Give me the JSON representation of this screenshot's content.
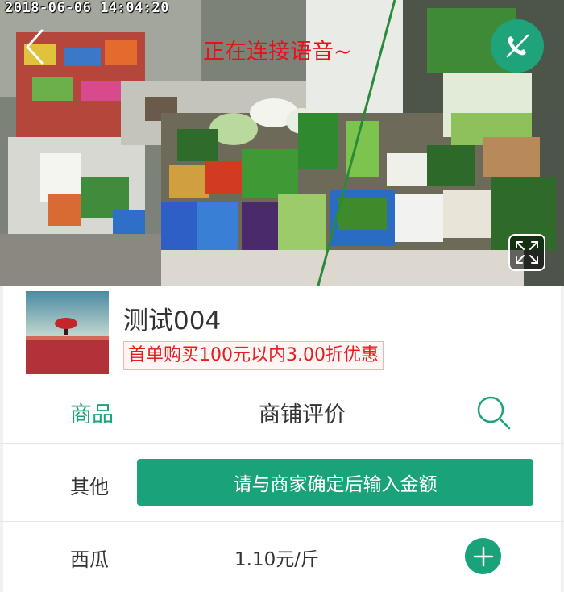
{
  "video": {
    "timestamp": "2018-06-06  14:04:20",
    "status_text": "正在连接语音~"
  },
  "store": {
    "name": "测试004",
    "promo": "首单购买100元以内3.00折优惠"
  },
  "tabs": [
    {
      "label": "商品",
      "active": true
    },
    {
      "label": "商铺评价",
      "active": false
    }
  ],
  "items": [
    {
      "name": "其他",
      "action_label": "请与商家确定后输入金额"
    },
    {
      "name": "西瓜",
      "price": "1.10元/斤"
    }
  ],
  "colors": {
    "accent": "#1aa37a",
    "promo_red": "#e41d1d",
    "status_red": "#e8101a"
  },
  "icons": {
    "back": "chevron-left-icon",
    "hangup": "phone-off-icon",
    "fullscreen": "expand-icon",
    "search": "search-icon",
    "add": "plus-icon"
  }
}
